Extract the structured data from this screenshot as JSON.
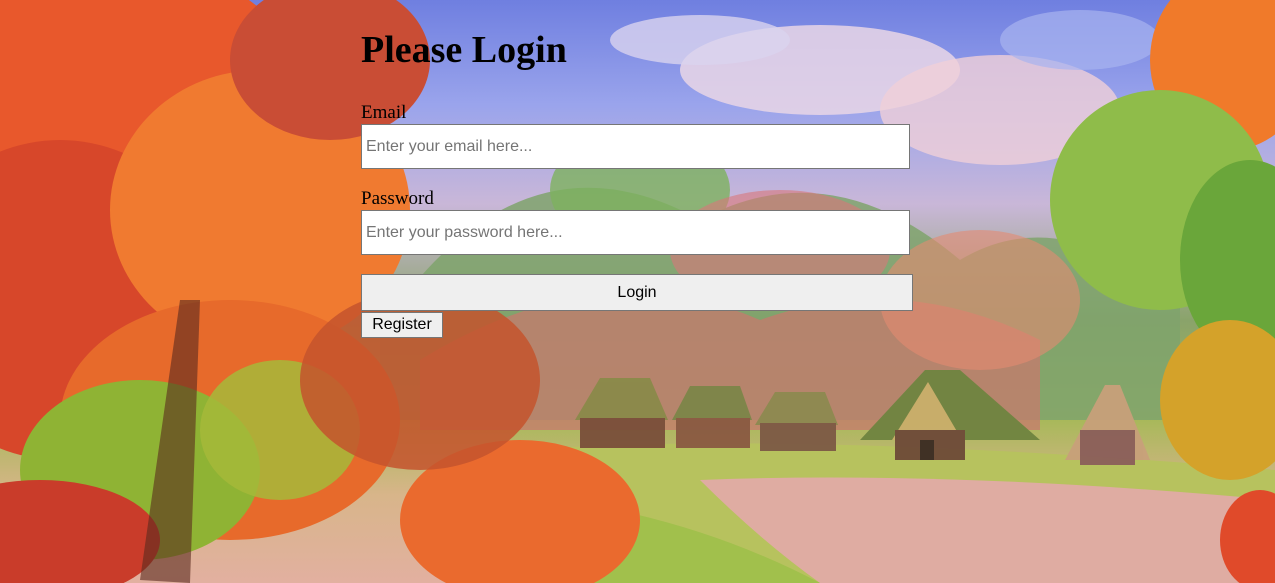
{
  "page": {
    "title": "Please Login"
  },
  "form": {
    "email_label": "Email",
    "email_placeholder": "Enter your email here...",
    "email_value": "",
    "password_label": "Password",
    "password_placeholder": "Enter your password here...",
    "password_value": "",
    "login_label": "Login",
    "register_label": "Register"
  },
  "background": {
    "description_icon": "painted-autumn-village-background"
  }
}
